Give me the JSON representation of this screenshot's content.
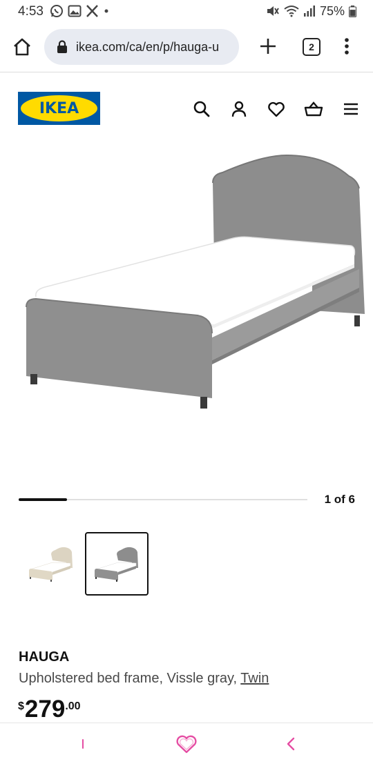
{
  "status_bar": {
    "time": "4:53",
    "left_icons": [
      "whatsapp-icon",
      "gallery-icon",
      "x-logo-icon",
      "notification-dot-icon"
    ],
    "right_icons": [
      "mute-icon",
      "wifi-icon",
      "signal-icon"
    ],
    "battery": "75%",
    "battery_level": 0.75
  },
  "browser": {
    "url": "ikea.com/ca/en/p/hauga-u",
    "tab_count": "2"
  },
  "site": {
    "logo_text": "IKEA",
    "brand_colors": {
      "blue": "#0058a3",
      "yellow": "#ffdb00"
    },
    "header_icons": [
      "search-icon",
      "account-icon",
      "favorites-icon",
      "cart-icon",
      "menu-icon"
    ]
  },
  "product": {
    "image_colors": {
      "fabric": "#8c8c8c",
      "mattress": "#ffffff",
      "legs": "#3a3a3a"
    },
    "carousel_counter": "1 of 6",
    "carousel_progress": 0.1667,
    "thumbnails": [
      {
        "variant": "beige",
        "selected": false
      },
      {
        "variant": "gray",
        "selected": true
      }
    ],
    "name": "HAUGA",
    "description_prefix": "Upholstered bed frame, Vissle gray, ",
    "size_link": "Twin",
    "price_currency": "$",
    "price_main": "279",
    "price_decimals": ".00"
  },
  "nav_bar": {
    "accent": "#e54da3"
  }
}
